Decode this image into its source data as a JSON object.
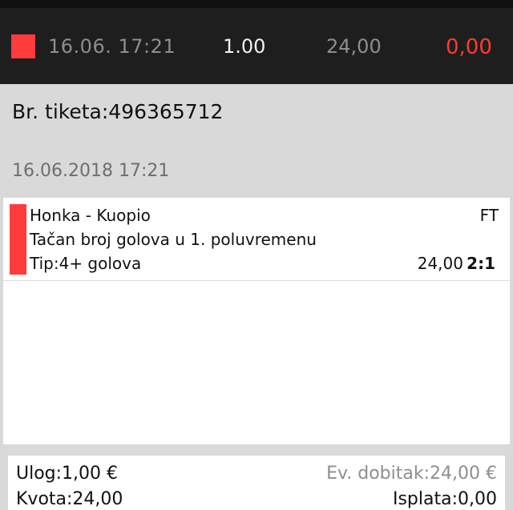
{
  "summary": {
    "status_color": "#ff3b3b",
    "datetime": "16.06. 17:21",
    "odds": "1.00",
    "stake": "24,00",
    "payout": "0,00"
  },
  "ticket": {
    "number_label": "Br. tiketa:496365712",
    "date": "16.06.2018 17:21"
  },
  "events": [
    {
      "match": "Honka - Kuopio",
      "status": "FT",
      "market": "Tačan broj golova u 1. poluvremenu",
      "tip": "Tip:4+ golova",
      "odds": "24,00",
      "score": "2:1"
    }
  ],
  "footer": {
    "stake_label": "Ulog:1,00 €",
    "possible_win_label": "Ev. dobitak:24,00 €",
    "odds_label": "Kvota:24,00",
    "payout_label": "Isplata:0,00"
  },
  "colors": {
    "accent_red": "#ff3b3b",
    "payout_red": "#ff3b30",
    "dark_bar": "#1e1e1e",
    "page_bg": "#d9d9d9"
  }
}
